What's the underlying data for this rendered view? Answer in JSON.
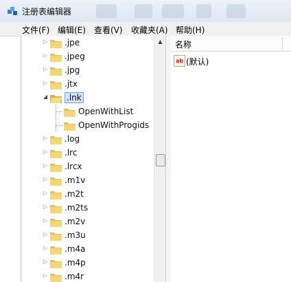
{
  "window": {
    "title": "注册表编辑器"
  },
  "menu": [
    {
      "label": "文件(F)"
    },
    {
      "label": "编辑(E)"
    },
    {
      "label": "查看(V)"
    },
    {
      "label": "收藏夹(A)"
    },
    {
      "label": "帮助(H)"
    }
  ],
  "tree": {
    "nodes": [
      {
        "label": ".jpe",
        "state": "collapsed"
      },
      {
        "label": ".jpeg",
        "state": "collapsed"
      },
      {
        "label": ".jpg",
        "state": "collapsed"
      },
      {
        "label": ".jtx",
        "state": "collapsed"
      },
      {
        "label": ".lnk",
        "state": "expanded",
        "selected": true
      },
      {
        "label": "OpenWithList",
        "level": 2
      },
      {
        "label": "OpenWithProgids",
        "level": 2
      },
      {
        "label": ".log",
        "state": "collapsed"
      },
      {
        "label": ".lrc",
        "state": "collapsed"
      },
      {
        "label": ".lrcx",
        "state": "collapsed"
      },
      {
        "label": ".m1v",
        "state": "collapsed"
      },
      {
        "label": ".m2t",
        "state": "collapsed"
      },
      {
        "label": ".m2ts",
        "state": "collapsed"
      },
      {
        "label": ".m2v",
        "state": "collapsed"
      },
      {
        "label": ".m3u",
        "state": "collapsed"
      },
      {
        "label": ".m4a",
        "state": "collapsed"
      },
      {
        "label": ".m4p",
        "state": "collapsed"
      },
      {
        "label": ".m4r",
        "state": "collapsed"
      }
    ]
  },
  "values_pane": {
    "column_name": "名称",
    "rows": [
      {
        "icon": "ab",
        "name": "(默认)"
      }
    ]
  },
  "colors": {
    "folder": "#e8bf52",
    "selection": "#cfe3fb"
  }
}
